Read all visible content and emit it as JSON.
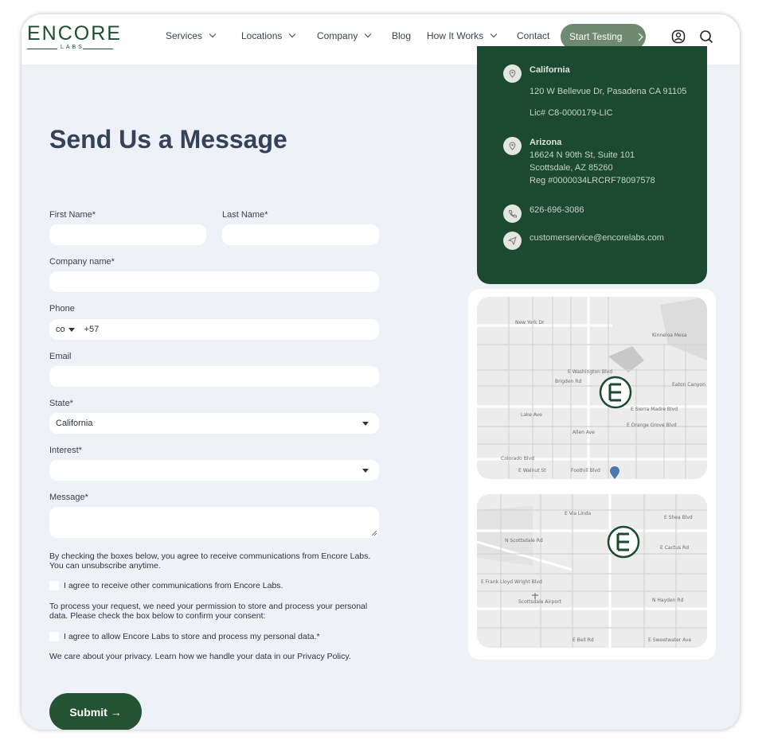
{
  "brand": {
    "name": "ENCORE",
    "sub": "LABS",
    "color": "#1e4d2f"
  },
  "nav": {
    "items": [
      "Services",
      "Locations",
      "Company",
      "Blog",
      "How It Works",
      "Contact"
    ],
    "cta": "Start Testing",
    "icons": [
      "account-icon",
      "search-icon"
    ]
  },
  "form": {
    "title": "Send Us a Message",
    "first_name_label": "First Name*",
    "first_name_value": "",
    "last_name_label": "Last Name*",
    "last_name_value": "",
    "company_label": "Company name*",
    "company_value": "",
    "phone_label": "Phone",
    "phone_country": "co",
    "phone_value": "+57",
    "email_label": "Email",
    "email_value": "",
    "state_label": "State*",
    "state_value": "California",
    "interest_label": "Interest*",
    "interest_value": "",
    "message_label": "Message*",
    "message_value": "",
    "consent_intro": "By checking the boxes below, you agree to receive communications from Encore Labs. You can unsubscribe anytime.",
    "consent_comms": "I agree to receive other communications from Encore Labs.",
    "process_intro": "To process your request, we need your permission to store and process your personal data. Please check the box below to confirm your consent:",
    "consent_data": "I agree to allow Encore Labs to store and process my personal data.*",
    "privacy_note": "We care about your privacy. Learn how we handle your data in our Privacy Policy.",
    "submit": "Submit →",
    "accent": "#245334"
  },
  "contact": {
    "california_title": "California",
    "california_address": "120 W Bellevue Dr, Pasadena CA 91105",
    "california_license": "Lic# C8-0000179-LIC",
    "arizona_title": "Arizona",
    "arizona_line1": "16624 N 90th St, Suite 101",
    "arizona_line2": "Scottsdale, AZ 85260",
    "arizona_line3": "Reg #0000034LRCRF78097578",
    "phone": "626-696-3086",
    "email": "customerservice@encorelabs.com",
    "panel_color": "#1c4a2f"
  },
  "map1": {
    "streets": [
      "New York Dr",
      "E Washington Blvd",
      "Brigden Rd",
      "E Sierra Madre Blvd",
      "E Orange Grove Blvd",
      "Lake Ave",
      "Allen Ave",
      "E Walnut St",
      "Foothill Blvd",
      "Colorado Blvd",
      "Eaton Canyon",
      "Kinneloa Mesa"
    ]
  },
  "map2": {
    "streets": [
      "E Via Linda",
      "E Shea Blvd",
      "E Cactus Rd",
      "E Bell Rd",
      "N Scottsdale Rd",
      "N Hayden Rd",
      "Scottsdale Airport",
      "E Frank Lloyd Wright Blvd",
      "E Sweetwater Ave"
    ]
  }
}
